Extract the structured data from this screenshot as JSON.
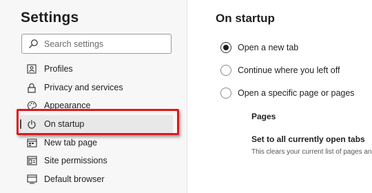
{
  "sidebar": {
    "title": "Settings",
    "search": {
      "placeholder": "Search settings",
      "value": ""
    },
    "items": [
      {
        "label": "Profiles",
        "icon": "profile-card-icon"
      },
      {
        "label": "Privacy and services",
        "icon": "lock-icon"
      },
      {
        "label": "Appearance",
        "icon": "palette-icon"
      },
      {
        "label": "On startup",
        "icon": "power-icon",
        "active": true
      },
      {
        "label": "New tab page",
        "icon": "new-tab-icon"
      },
      {
        "label": "Site permissions",
        "icon": "site-permissions-icon"
      },
      {
        "label": "Default browser",
        "icon": "default-browser-icon"
      }
    ]
  },
  "main": {
    "title": "On startup",
    "options": [
      {
        "label": "Open a new tab",
        "checked": true
      },
      {
        "label": "Continue where you left off",
        "checked": false
      },
      {
        "label": "Open a specific page or pages",
        "checked": false
      }
    ],
    "pages_heading": "Pages",
    "set_all_heading": "Set to all currently open tabs",
    "set_all_description": "This clears your current list of pages and"
  },
  "colors": {
    "highlight": "#e0161c",
    "sidebar_bg": "#f7f7f7",
    "active_bg": "#e8e8e8"
  }
}
